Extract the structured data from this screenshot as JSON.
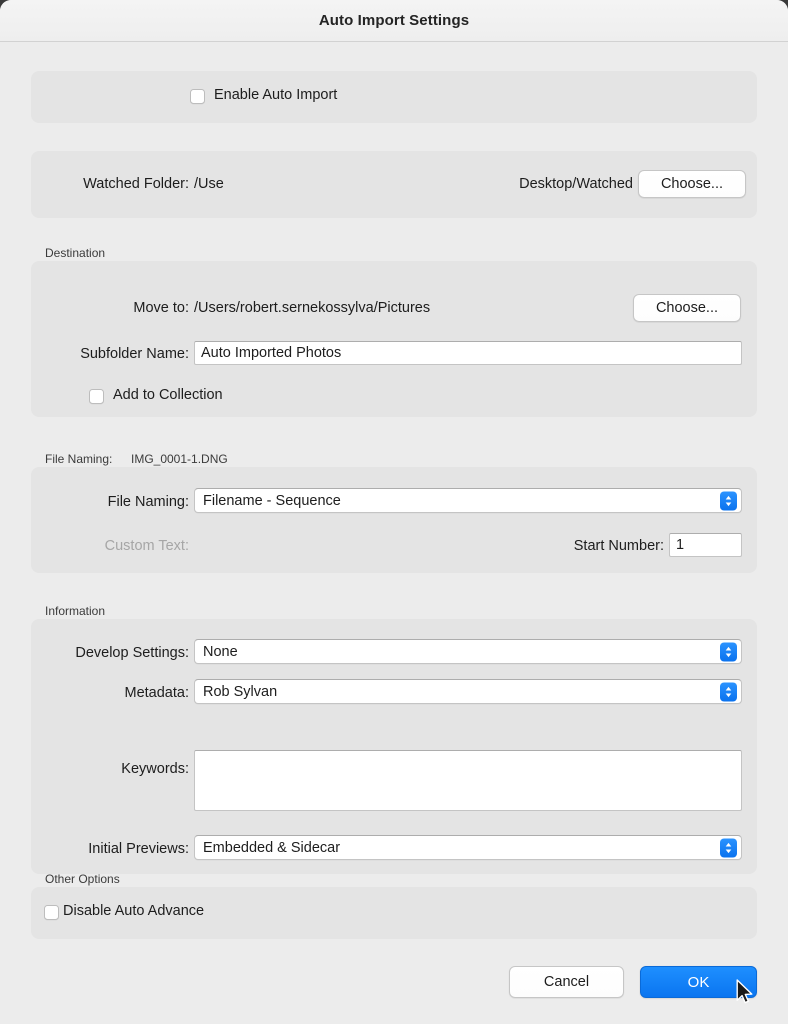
{
  "window": {
    "title": "Auto Import Settings"
  },
  "enable": {
    "label": "Enable Auto Import",
    "checked": false
  },
  "watched_folder": {
    "label": "Watched Folder:",
    "path_start": "/Use",
    "path_end": "Desktop/Watched",
    "choose_label": "Choose..."
  },
  "destination": {
    "section_label": "Destination",
    "move_to_label": "Move to:",
    "move_to_path": "/Users/robert.sernekossylva/Pictures",
    "choose_label": "Choose...",
    "subfolder_label": "Subfolder Name:",
    "subfolder_value": "Auto Imported Photos",
    "add_to_collection_label": "Add to Collection",
    "add_to_collection_checked": false
  },
  "file_naming": {
    "section_label": "File Naming:",
    "section_preview": "IMG_0001-1.DNG",
    "naming_label": "File Naming:",
    "naming_value": "Filename - Sequence",
    "custom_text_label": "Custom Text:",
    "custom_text_value": "",
    "start_number_label": "Start Number:",
    "start_number_value": "1"
  },
  "information": {
    "section_label": "Information",
    "develop_label": "Develop Settings:",
    "develop_value": "None",
    "metadata_label": "Metadata:",
    "metadata_value": "Rob Sylvan",
    "keywords_label": "Keywords:",
    "keywords_value": "",
    "previews_label": "Initial Previews:",
    "previews_value": "Embedded & Sidecar"
  },
  "other_options": {
    "section_label": "Other Options",
    "disable_auto_advance_label": "Disable Auto Advance",
    "disable_auto_advance_checked": false
  },
  "footer": {
    "cancel_label": "Cancel",
    "ok_label": "OK"
  },
  "colors": {
    "accent": "#0a75f0",
    "window_bg": "#ececec",
    "panel_bg": "#e4e4e4",
    "titlebar_bg": "#f2f2f2"
  }
}
